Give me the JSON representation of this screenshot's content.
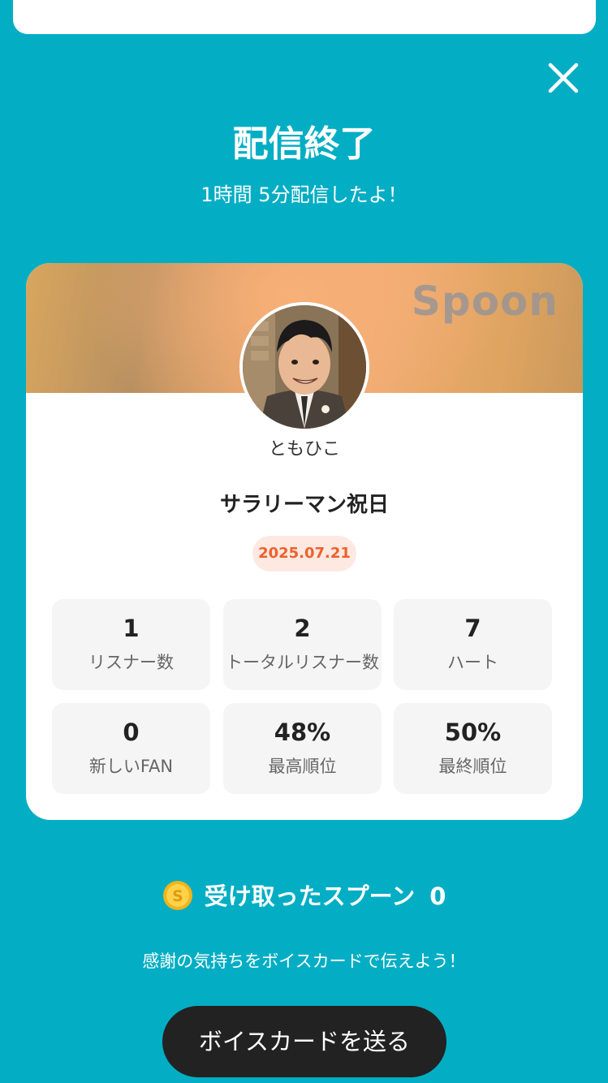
{
  "header": {
    "title": "配信終了",
    "subtitle": "1時間 5分配信したよ！"
  },
  "card": {
    "brand": "Spoon",
    "username": "ともひこ",
    "stream_title": "サラリーマン祝日",
    "date": "2025.07.21",
    "stats": [
      {
        "value": "1",
        "label": "リスナー数"
      },
      {
        "value": "2",
        "label": "トータルリスナー数"
      },
      {
        "value": "7",
        "label": "ハート"
      },
      {
        "value": "0",
        "label": "新しいFAN"
      },
      {
        "value": "48%",
        "label": "最高順位"
      },
      {
        "value": "50%",
        "label": "最終順位"
      }
    ]
  },
  "spoons": {
    "label": "受け取ったスプーン",
    "count": "0"
  },
  "thanks_text": "感謝の気持ちをボイスカードで伝えよう！",
  "send_button_label": "ボイスカードを送る",
  "icons": {
    "close": "close-icon",
    "coin": "spoon-coin-icon",
    "avatar": "user-avatar"
  },
  "colors": {
    "background": "#03aec4",
    "date_badge_text": "#f0602a",
    "date_badge_bg": "#fde9e1",
    "button_bg": "#222222"
  }
}
